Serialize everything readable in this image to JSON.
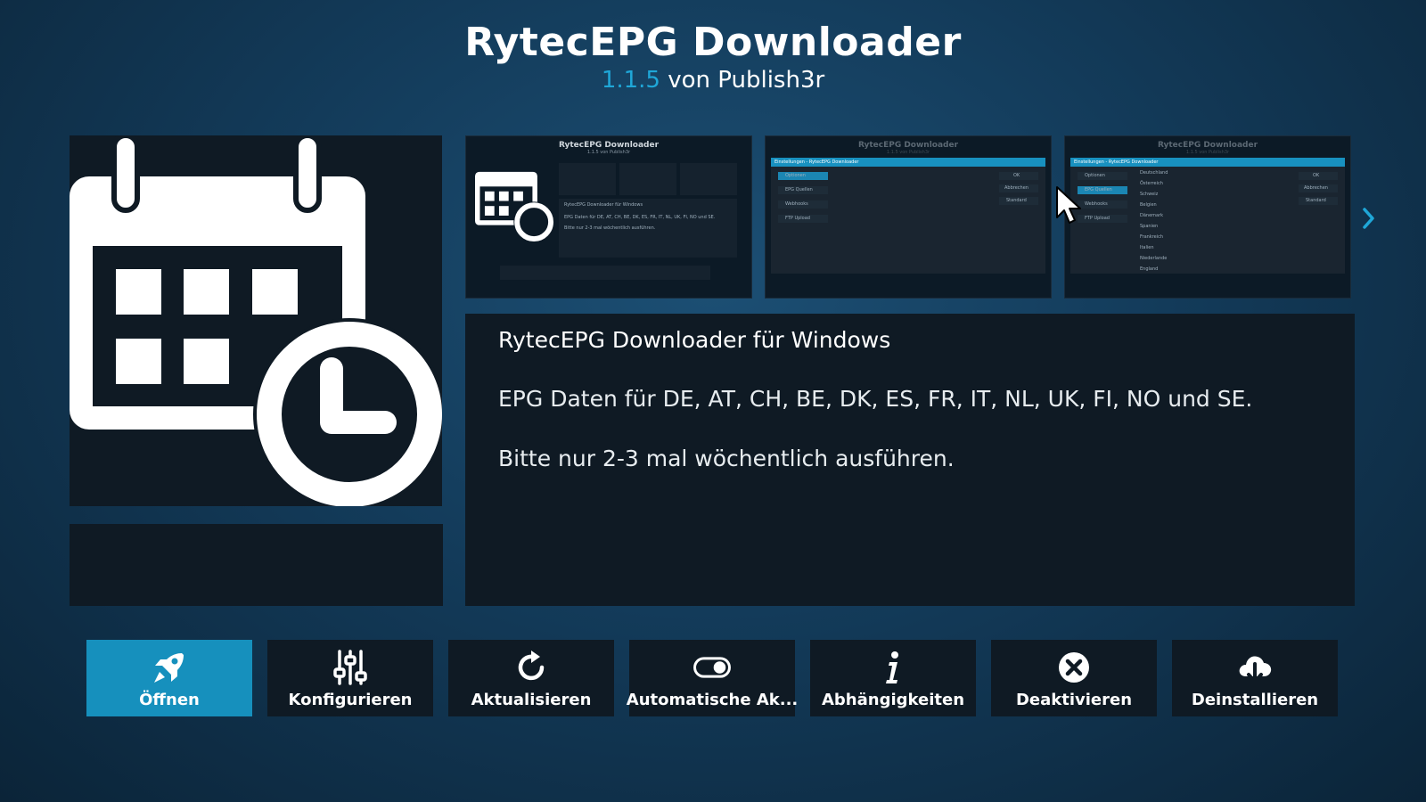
{
  "header": {
    "title": "RytecEPG Downloader",
    "version": "1.1.5",
    "author_text": "von Publish3r"
  },
  "screenshots": [
    {
      "title": "RytecEPG Downloader",
      "subtitle": "1.1.5 von Publish3r",
      "desc_title": "RytecEPG Downloader für Windows",
      "desc_line1": "EPG Daten für DE, AT, CH, BE, DK, ES, FR, IT, NL, UK, FI, NO und SE.",
      "desc_line2": "Bitte nur 2-3 mal wöchentlich ausführen."
    },
    {
      "title": "RytecEPG Downloader",
      "subtitle": "1.1.5 von Publish3r",
      "bar_text": "Einstellungen - RytecEPG Downloader",
      "menu": [
        "Optionen",
        "EPG Quellen",
        "Webhooks",
        "FTP Upload"
      ],
      "right": [
        "OK",
        "Abbrechen",
        "Standard"
      ]
    },
    {
      "title": "RytecEPG Downloader",
      "subtitle": "1.1.5 von Publish3r",
      "bar_text": "Einstellungen - RytecEPG Downloader",
      "menu": [
        "Optionen",
        "EPG Quellen",
        "Webhooks",
        "FTP Upload"
      ],
      "list": [
        "Deutschland",
        "Österreich",
        "Schweiz",
        "Belgien",
        "Dänemark",
        "Spanien",
        "Frankreich",
        "Italien",
        "Niederlande",
        "England"
      ],
      "right": [
        "OK",
        "Abbrechen",
        "Standard"
      ]
    }
  ],
  "description": {
    "title": "RytecEPG Downloader für Windows",
    "line1": "EPG Daten für DE, AT, CH, BE, DK, ES, FR, IT, NL, UK, FI, NO und SE.",
    "line2": "Bitte nur 2-3 mal wöchentlich ausführen."
  },
  "buttons": [
    {
      "label": "Öffnen",
      "icon": "rocket-icon",
      "active": true
    },
    {
      "label": "Konfigurieren",
      "icon": "sliders-icon"
    },
    {
      "label": "Aktualisieren",
      "icon": "refresh-icon"
    },
    {
      "label": "Automatische Ak...",
      "icon": "toggle-icon"
    },
    {
      "label": "Abhängigkeiten",
      "icon": "info-icon"
    },
    {
      "label": "Deaktivieren",
      "icon": "close-circle-icon"
    },
    {
      "label": "Deinstallieren",
      "icon": "cloud-download-icon"
    }
  ],
  "colors": {
    "accent": "#1690bd",
    "version": "#1fa7d8",
    "panel": "#0f1a24"
  }
}
